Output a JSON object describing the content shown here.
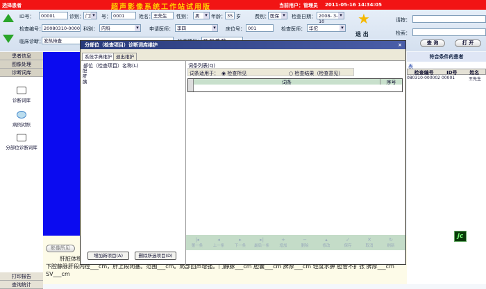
{
  "header": {
    "select_patient": "选择患者",
    "title": "超声影像系统工作站试用版",
    "current_user": "当前用户：管理员",
    "datetime": "2011-05-16 14:34:05"
  },
  "form": {
    "id_label": "ID号：",
    "id_value": "00001",
    "visit_type_label": "诊别：",
    "visit_type": "门诊",
    "number_label": "号：",
    "number_value": "0001",
    "name_label": "姓名：",
    "name_value": "王先生",
    "sex_label": "性别：",
    "sex_value": "男",
    "age_label": "年龄：",
    "age_value": "35",
    "age_unit": "岁",
    "fee_label": "费别：",
    "fee_value": "医保",
    "date_label": "检查日期：",
    "date_value": "2008- 3-10",
    "exam_no_label": "检查编号：",
    "exam_no_value": "20080310-000002",
    "dept_label": "科别：",
    "dept_value": "内科",
    "req_doctor_label": "申请医师：",
    "req_doctor_value": "李四",
    "bed_label": "床位号：",
    "bed_value": "001",
    "exam_doctor_label": "检查医师：",
    "exam_doctor_value": "华佗",
    "diagnosis_label": "临床诊断：",
    "diagnosis_value": "发热待查",
    "exam_item_label": "检查项目：",
    "exam_item_value": "肝 胆 脾 胰"
  },
  "exit_label": "退  出",
  "search": {
    "request_label": "请按：",
    "search_label": "检索：",
    "query_button": "查 询",
    "open_button": "打 开",
    "result_title": "符合条件的患者",
    "list_label": "表",
    "columns": [
      "检查编号",
      "ID号",
      "姓名"
    ],
    "rows": [
      [
        "20080310-000002",
        "00001",
        "王先生"
      ]
    ]
  },
  "sidebar": {
    "tabs": [
      "患者信息",
      "图像处理",
      "诊断词库"
    ],
    "tools": [
      "诊断词库",
      "病例对照",
      "分部位诊断词库"
    ],
    "bottom": [
      "打印报告",
      "查询统计"
    ]
  },
  "report": {
    "image_findings_button": "影像所见",
    "text": "肝脏体积……样。点状回声增粗、不均匀。肝静脉汇入下腔静脉开口处显示不清，三支肝静脉稍增宽，相互间见侨状通路，最宽___cm。___下腔静脉肝段内径___cm，肝上段闭塞。范围___cm。局部回声增强。门静脉___cm 胆囊___cm 脾厚___cm 轻度水肿 胆管不扩张 脾厚___cm SV___cm"
  },
  "dialog": {
    "title": "分部位（检查项目）诊断词库维护",
    "tabs": [
      "系统字典维护",
      "退出维护"
    ],
    "parts_label": "部位（检查项目）名称(L)",
    "parts": [
      "胆",
      "肝",
      "胰"
    ],
    "terms_label": "词条列表(Q)",
    "applies_label": "词条适用于：",
    "radio_findings": "检查所见",
    "radio_conclusion": "检查结果（检查意见）",
    "radio_selected": "检查所见",
    "columns": [
      "词条",
      "序号"
    ],
    "add_button": "增加新项目(A)",
    "delete_button": "删除所选项目(D)",
    "nav": [
      "第一条",
      "上一条",
      "下一条",
      "最后一条",
      "增加",
      "删除",
      "修改",
      "保存",
      "取消",
      "刷新"
    ]
  },
  "badge": "jc"
}
